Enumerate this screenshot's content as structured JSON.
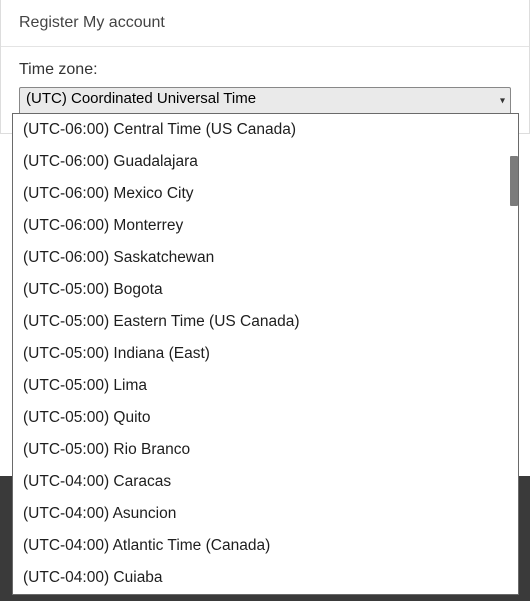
{
  "header": {
    "title": "Register My account"
  },
  "form": {
    "timezone_label": "Time zone:",
    "timezone_selected": "(UTC) Coordinated Universal Time"
  },
  "dropdown": {
    "options": [
      {
        "label": "(UTC-06:00) Central Time (US Canada)"
      },
      {
        "label": "(UTC-06:00) Guadalajara"
      },
      {
        "label": "(UTC-06:00) Mexico City"
      },
      {
        "label": "(UTC-06:00) Monterrey"
      },
      {
        "label": "(UTC-06:00) Saskatchewan"
      },
      {
        "label": "(UTC-05:00) Bogota"
      },
      {
        "label": "(UTC-05:00) Eastern Time (US Canada)"
      },
      {
        "label": "(UTC-05:00) Indiana (East)"
      },
      {
        "label": "(UTC-05:00) Lima"
      },
      {
        "label": "(UTC-05:00) Quito"
      },
      {
        "label": "(UTC-05:00) Rio Branco"
      },
      {
        "label": "(UTC-04:00) Caracas"
      },
      {
        "label": "(UTC-04:00) Asuncion"
      },
      {
        "label": "(UTC-04:00) Atlantic Time (Canada)"
      },
      {
        "label": "(UTC-04:00) Cuiaba"
      }
    ]
  }
}
